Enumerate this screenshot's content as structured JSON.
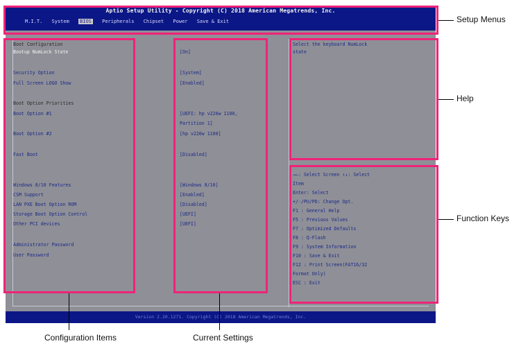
{
  "header": {
    "title": "Aptio Setup Utility - Copyright (C) 2018 American Megatrends, Inc.",
    "menus": [
      "M.I.T.",
      "System",
      "BIOS",
      "Peripherals",
      "Chipset",
      "Power",
      "Save & Exit"
    ],
    "active_menu": "BIOS"
  },
  "config": {
    "boot_configuration": "Boot Configuration",
    "bootup_numlock": "Bootup NumLock State",
    "security_option": "Security Option",
    "full_screen_logo": "Full Screen LOGO Show",
    "boot_option_priorities": "Boot Option Priorities",
    "boot_option_1": "Boot Option #1",
    "boot_option_2": "Boot Option #2",
    "fast_boot": "Fast Boot",
    "windows_features": "Windows 8/10 Features",
    "csm_support": "CSM Support",
    "lan_pxe": "LAN PXE Boot Option ROM",
    "storage_boot": "Storage Boot Option Control",
    "other_pci": "Other PCI devices",
    "admin_password": "Administrator Password",
    "user_password": "User Password"
  },
  "values": {
    "numlock": "[On]",
    "security": "[System]",
    "logo": "[Enabled]",
    "boot1_line1": "[UEFI: hp v220w 1100,",
    "boot1_line2": "Partition 1]",
    "boot2": "[hp v220w 1100]",
    "fast_boot": "[Disabled]",
    "windows": "[Windows 8/10]",
    "csm": "[Enabled]",
    "lan": "[Disabled]",
    "storage": "[UEFI]",
    "other_pci": "[UEFI]"
  },
  "help": {
    "line1": "Select the keyboard NumLock",
    "line2": "state"
  },
  "function_keys": [
    "→←: Select Screen  ↑↓: Select",
    "Item",
    "Enter: Select",
    "+/-/PU/PD: Change Opt.",
    "F1  : General Help",
    "F5  : Previous Values",
    "F7  : Optimized Defaults",
    "F8  : Q-Flash",
    "F9  : System Information",
    "F10 : Save & Exit",
    "F12 : Print Screen(FAT16/32",
    "Format Only)",
    "ESC : Exit"
  ],
  "footer": {
    "version": "Version 2.20.1271. Copyright (C) 2018 American Megatrends, Inc."
  },
  "callouts": {
    "setup_menus": "Setup Menus",
    "help": "Help",
    "function_keys": "Function Keys",
    "configuration_items": "Configuration Items",
    "current_settings": "Current Settings"
  },
  "colors": {
    "bios_background": "#8f8f97",
    "bar_blue": "#0b1786",
    "highlight_box": "#ee2378"
  }
}
